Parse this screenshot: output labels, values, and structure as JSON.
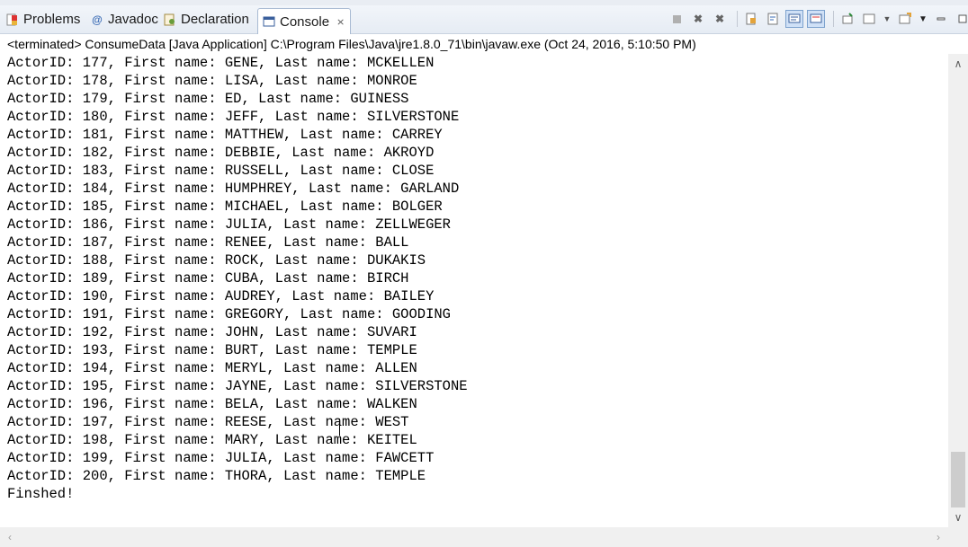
{
  "tabs": [
    {
      "label": "Problems",
      "icon": "problems-icon"
    },
    {
      "label": "Javadoc",
      "icon": "at-icon"
    },
    {
      "label": "Declaration",
      "icon": "declaration-icon"
    },
    {
      "label": "Console",
      "icon": "console-icon",
      "active": true
    }
  ],
  "status_line": "<terminated> ConsumeData [Java Application] C:\\Program Files\\Java\\jre1.8.0_71\\bin\\javaw.exe (Oct 24, 2016, 5:10:50 PM)",
  "output_lines": [
    "ActorID: 177, First name: GENE, Last name: MCKELLEN",
    "ActorID: 178, First name: LISA, Last name: MONROE",
    "ActorID: 179, First name: ED, Last name: GUINESS",
    "ActorID: 180, First name: JEFF, Last name: SILVERSTONE",
    "ActorID: 181, First name: MATTHEW, Last name: CARREY",
    "ActorID: 182, First name: DEBBIE, Last name: AKROYD",
    "ActorID: 183, First name: RUSSELL, Last name: CLOSE",
    "ActorID: 184, First name: HUMPHREY, Last name: GARLAND",
    "ActorID: 185, First name: MICHAEL, Last name: BOLGER",
    "ActorID: 186, First name: JULIA, Last name: ZELLWEGER",
    "ActorID: 187, First name: RENEE, Last name: BALL",
    "ActorID: 188, First name: ROCK, Last name: DUKAKIS",
    "ActorID: 189, First name: CUBA, Last name: BIRCH",
    "ActorID: 190, First name: AUDREY, Last name: BAILEY",
    "ActorID: 191, First name: GREGORY, Last name: GOODING",
    "ActorID: 192, First name: JOHN, Last name: SUVARI",
    "ActorID: 193, First name: BURT, Last name: TEMPLE",
    "ActorID: 194, First name: MERYL, Last name: ALLEN",
    "ActorID: 195, First name: JAYNE, Last name: SILVERSTONE",
    "ActorID: 196, First name: BELA, Last name: WALKEN",
    "ActorID: 197, First name: REESE, Last name: WEST",
    "ActorID: 198, First name: MARY, Last name: KEITEL",
    "ActorID: 199, First name: JULIA, Last name: FAWCETT",
    "ActorID: 200, First name: THORA, Last name: TEMPLE",
    "Finshed!"
  ],
  "toolbar_icons": [
    "terminate-icon",
    "remove-launch-icon",
    "remove-all-terminated-icon",
    "scroll-lock-icon",
    "word-wrap-icon",
    "show-console-on-stdout-icon",
    "show-console-on-stderr-icon",
    "pin-console-icon",
    "display-selected-console-icon",
    "open-console-icon",
    "view-menu-icon",
    "minimize-icon",
    "maximize-icon"
  ],
  "colors": {
    "tab_bar_bg": "#e6ecf4",
    "active_tab_border": "#a9bbd3",
    "text": "#000000",
    "scrollbar_bg": "#f0f0f0"
  }
}
